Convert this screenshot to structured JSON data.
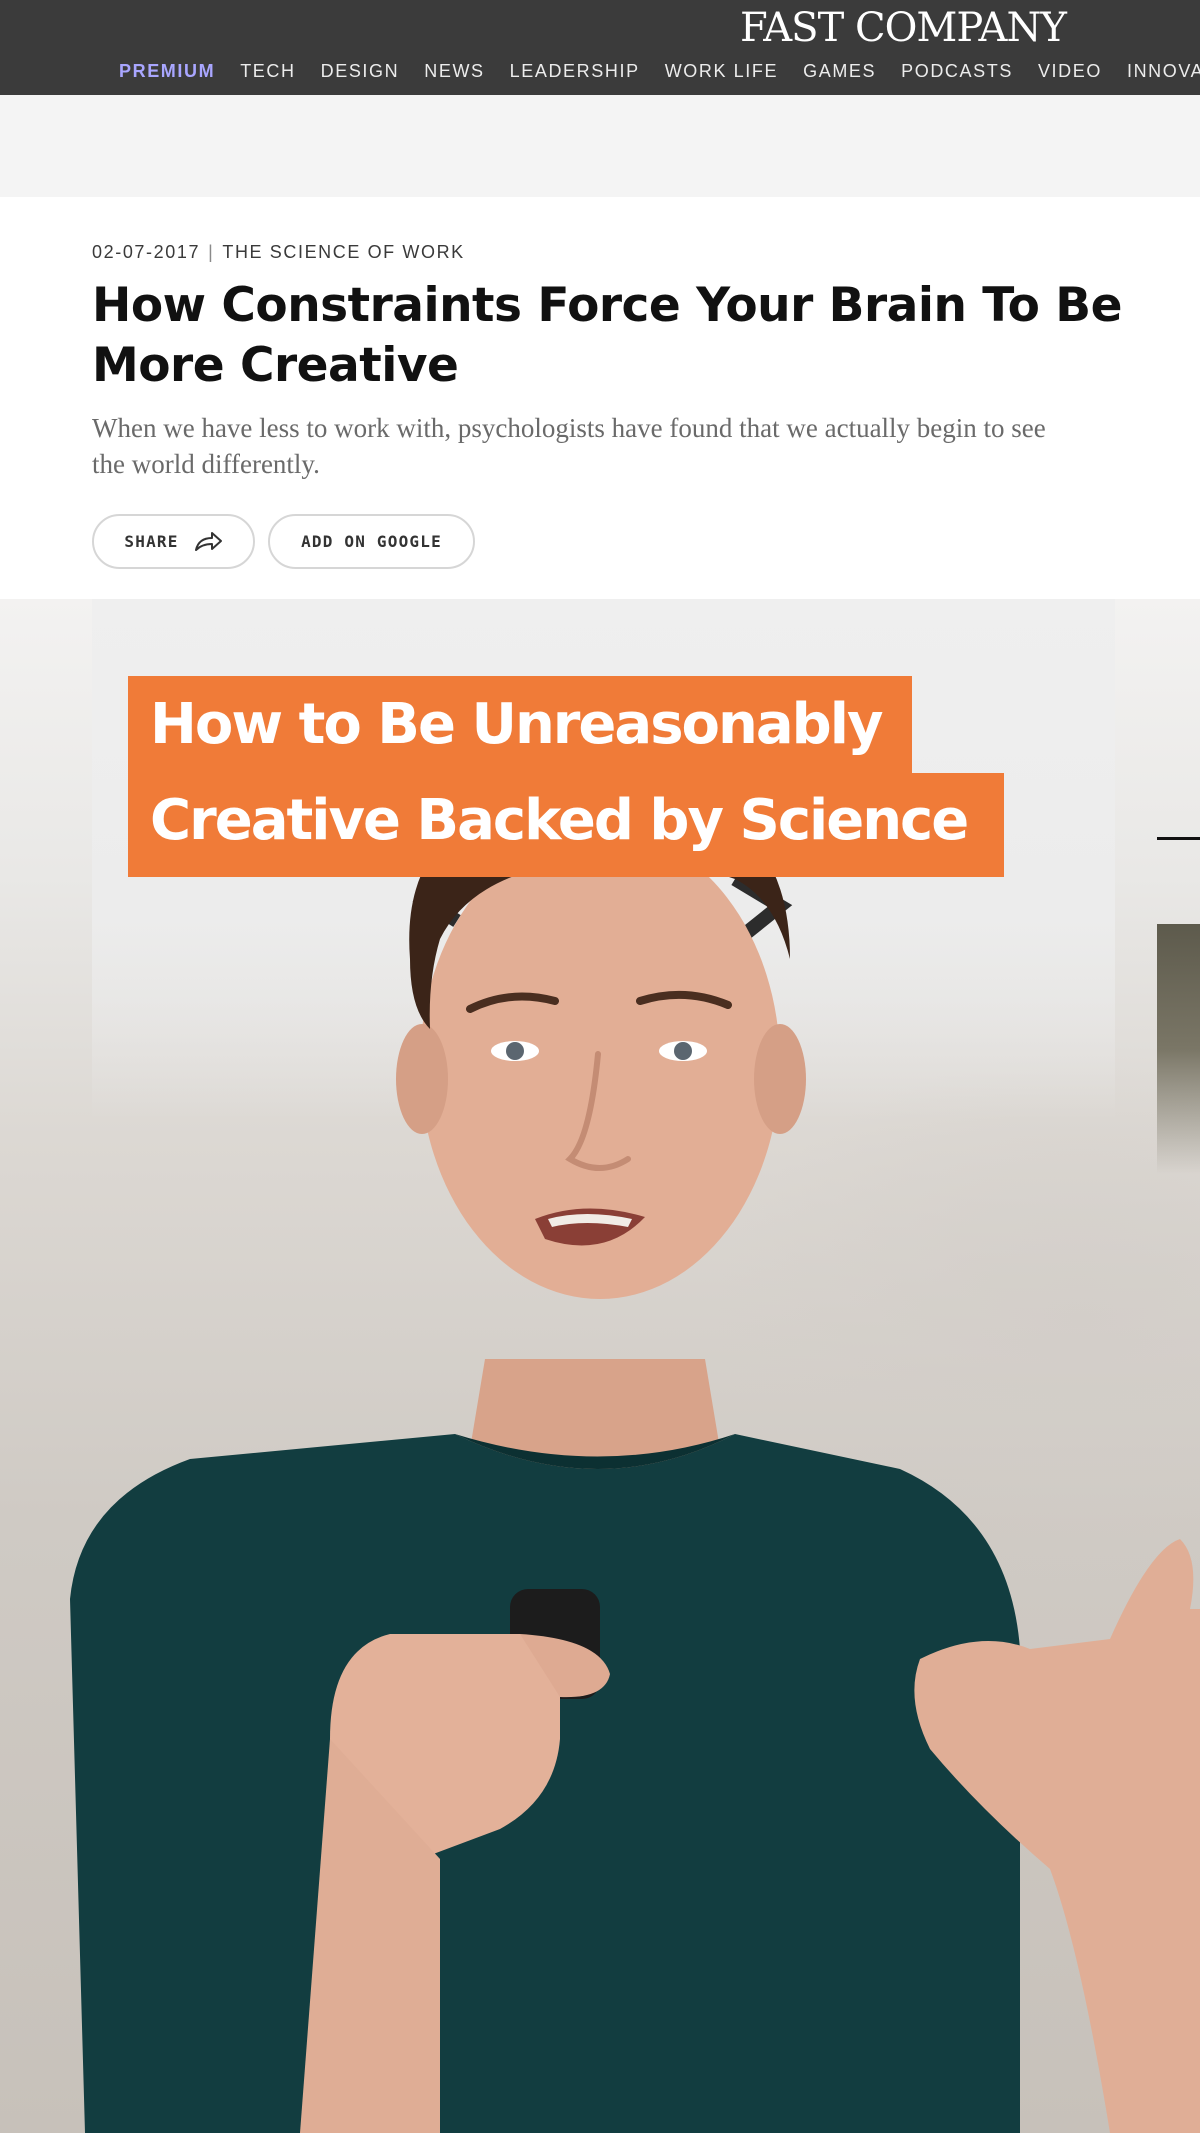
{
  "header": {
    "logo": "FAST COMPANY",
    "nav": [
      "PREMIUM",
      "TECH",
      "DESIGN",
      "NEWS",
      "LEADERSHIP",
      "WORK LIFE",
      "GAMES",
      "PODCASTS",
      "VIDEO",
      "INNOVAT"
    ]
  },
  "article": {
    "date": "02-07-2017",
    "separator": "|",
    "section": "THE SCIENCE OF WORK",
    "title": "How Constraints Force Your Brain To Be More Creative",
    "dek": "When we have less to work with, psychologists have found that we actually begin to see the world differently.",
    "share_label": "SHARE",
    "google_label": "ADD ON GOOGLE"
  },
  "video": {
    "title_line1": "How to Be Unreasonably",
    "title_line2": "Creative Backed by Science"
  },
  "icons": {
    "share": "share-arrow-icon"
  },
  "colors": {
    "header_bg": "#3b3b3b",
    "premium": "#a9a6ff",
    "overlay_orange": "#f07b38",
    "shirt": "#123d40"
  }
}
